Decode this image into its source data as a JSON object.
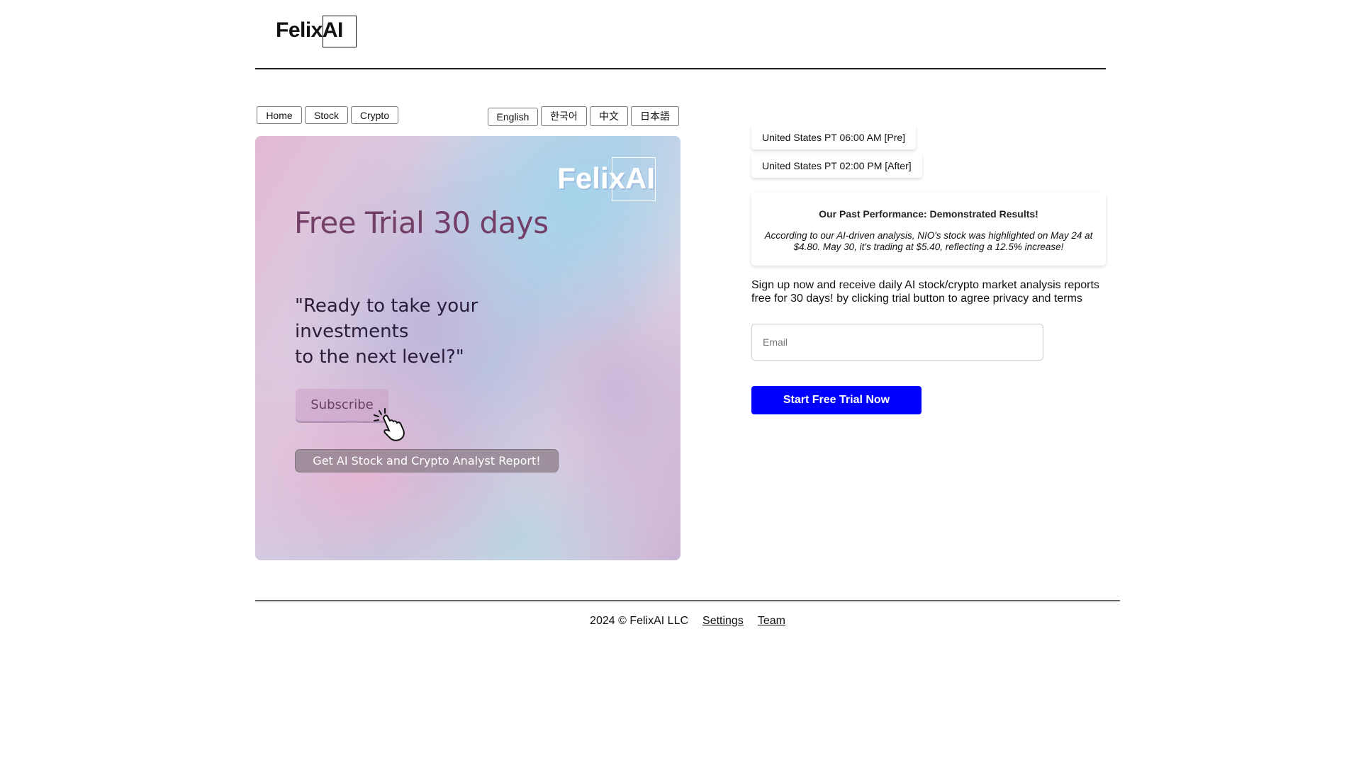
{
  "header": {
    "logo": "FelixAI"
  },
  "nav": [
    {
      "label": "Home"
    },
    {
      "label": "Stock"
    },
    {
      "label": "Crypto"
    }
  ],
  "languages": [
    {
      "label": "English"
    },
    {
      "label": "한국어"
    },
    {
      "label": "中文"
    },
    {
      "label": "日本語"
    }
  ],
  "hero": {
    "logo": "FelixAI",
    "title": "Free Trial 30 days",
    "quote": "\"Ready to take your\ninvestments\nto the next level?\"",
    "subscribe_label": "Subscribe",
    "report_label": "Get AI Stock and Crypto Analyst Report!"
  },
  "schedule": [
    {
      "label": "United States PT 06:00 AM [Pre]"
    },
    {
      "label": "United States PT 02:00 PM [After]"
    }
  ],
  "performance": {
    "title": "Our Past Performance: Demonstrated Results!",
    "body": "According to our AI-driven analysis, NIO's stock was highlighted on May 24 at $4.80. May 30, it's trading at $5.40, reflecting a 12.5% increase!"
  },
  "signup": {
    "text": "Sign up now and receive daily AI stock/crypto market analysis reports free for 30 days! by clicking trial button to agree privacy and terms",
    "email_placeholder": "Email",
    "cta_label": "Start Free Trial Now",
    "cta_color": "#0000ff"
  },
  "footer": {
    "copyright": "2024 © FelixAI LLC",
    "links": [
      {
        "label": "Settings"
      },
      {
        "label": "Team"
      }
    ]
  }
}
